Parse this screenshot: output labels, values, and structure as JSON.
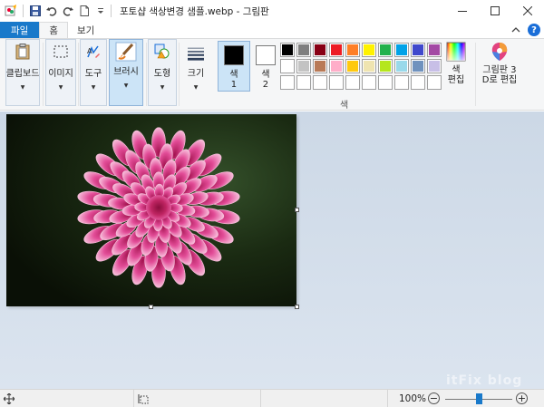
{
  "window": {
    "title": "포토샵 색상변경 샘플.webp - 그림판"
  },
  "tabs": [
    {
      "label": "파일"
    },
    {
      "label": "홈"
    },
    {
      "label": "보기"
    }
  ],
  "ribbon": {
    "clipboard_label": "클립보드",
    "image_label": "이미지",
    "tools_label": "도구",
    "brushes_label": "브러시",
    "shapes_label": "도형",
    "size_label": "크기",
    "color1_label": "색\n1",
    "color2_label": "색\n2",
    "colors_group_label": "색",
    "edit_colors_label": "색\n편집",
    "paint3d_label": "그림판 3\nD로 편집"
  },
  "colors": {
    "color1": "#000000",
    "color2": "#ffffff",
    "palette": [
      "#000000",
      "#7f7f7f",
      "#880015",
      "#ed1c24",
      "#ff7f27",
      "#fff200",
      "#22b14c",
      "#00a2e8",
      "#3f48cc",
      "#a349a4",
      "#ffffff",
      "#c3c3c3",
      "#b97a57",
      "#ffaec9",
      "#ffc90e",
      "#efe4b0",
      "#b5e61d",
      "#99d9ea",
      "#7092be",
      "#c8bfe7",
      "",
      "",
      "",
      "",
      "",
      "",
      "",
      "",
      "",
      ""
    ],
    "accent": "#1979ca"
  },
  "status": {
    "zoom": "100%",
    "zoom_minus": "−",
    "zoom_plus": "+",
    "zoom_level": 0.5
  },
  "watermark": "itFix blog"
}
